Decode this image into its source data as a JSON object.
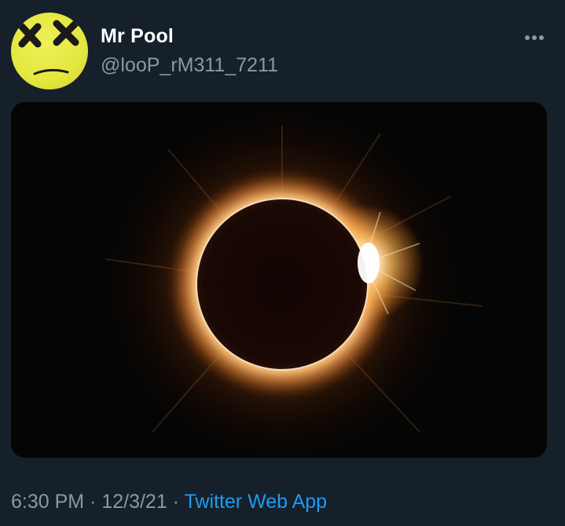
{
  "tweet": {
    "author": {
      "display_name": "Mr Pool",
      "handle": "@looP_rM311_7211"
    },
    "timestamp": {
      "time": "6:30 PM",
      "separator_1": " · ",
      "date": "12/3/21",
      "separator_2": " · ",
      "source": "Twitter Web App"
    },
    "media": {
      "subject": "solar eclipse diamond ring"
    }
  },
  "icons": {
    "avatar": "deadpool-face-icon",
    "more": "more-dots-icon"
  },
  "colors": {
    "background": "#15202b",
    "name": "#ffffff",
    "secondary_text": "#8899a6",
    "link": "#1d9bf0",
    "avatar_yellow": "#e4e73e"
  }
}
